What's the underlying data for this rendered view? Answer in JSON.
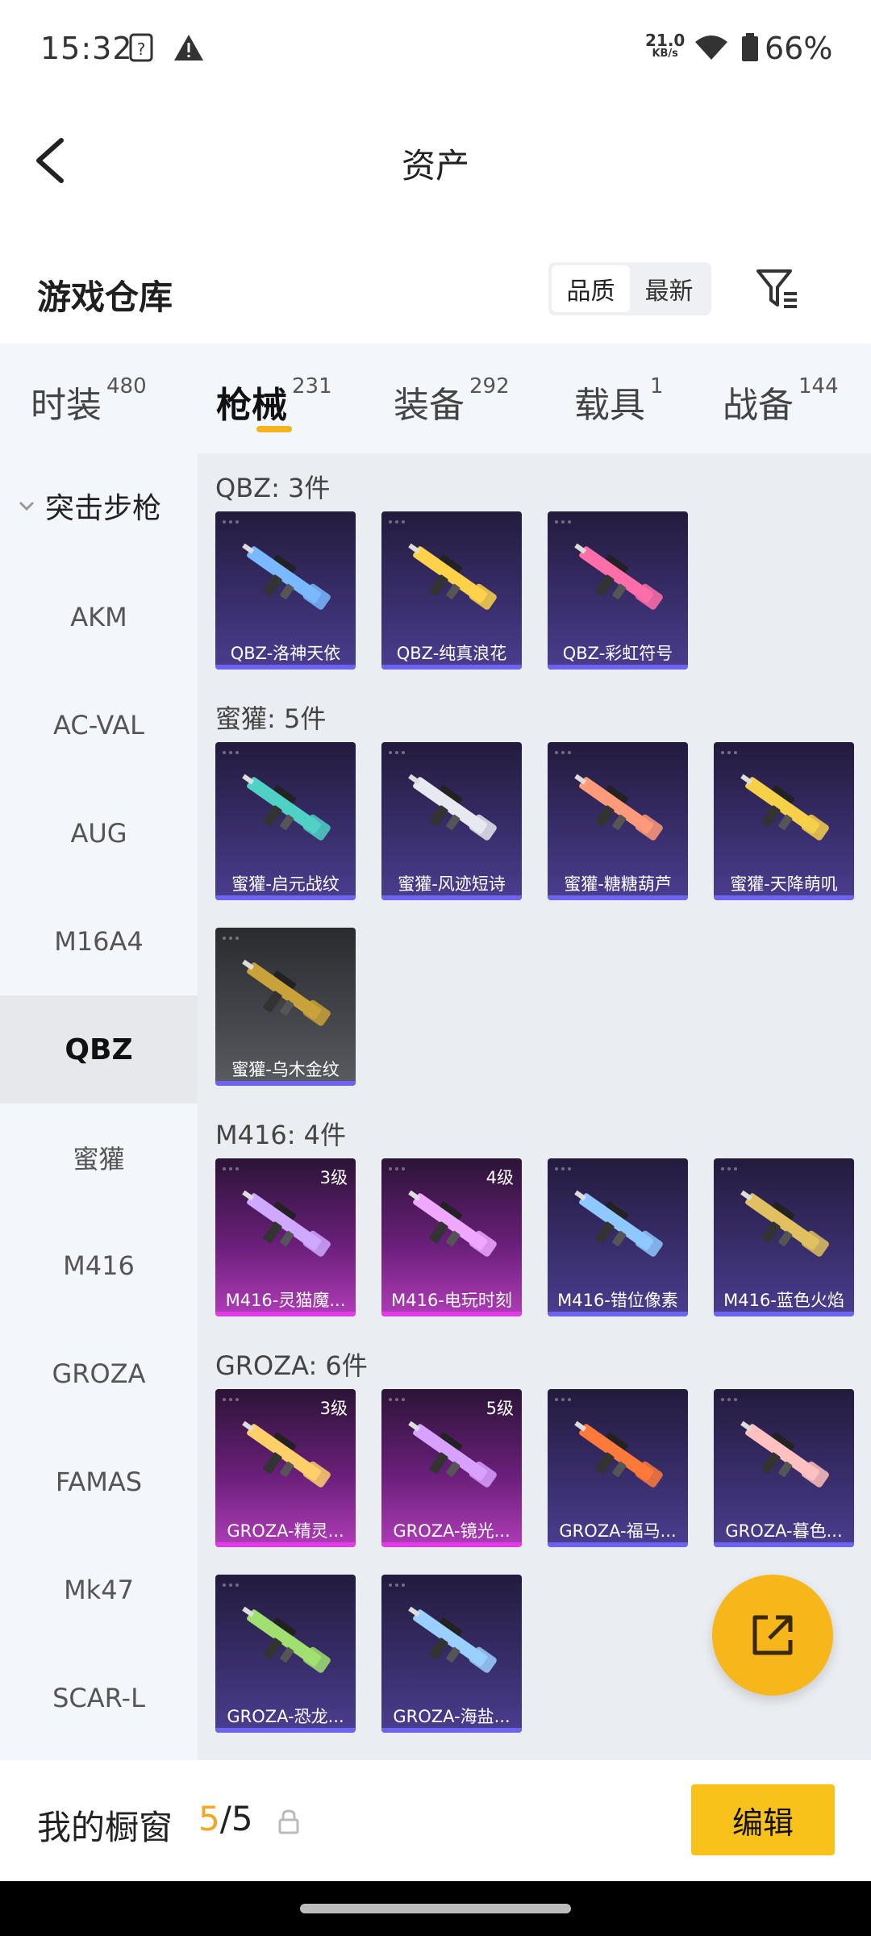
{
  "status_bar": {
    "time": "15:32",
    "net_speed_value": "21.0",
    "net_speed_unit": "KB/s",
    "battery": "66%"
  },
  "header": {
    "title": "资产"
  },
  "section": {
    "title": "游戏仓库",
    "sort_options": [
      "品质",
      "最新"
    ],
    "sort_selected": "品质"
  },
  "categories": [
    {
      "label": "时装",
      "count": "480"
    },
    {
      "label": "枪械",
      "count": "231"
    },
    {
      "label": "装备",
      "count": "292"
    },
    {
      "label": "载具",
      "count": "1"
    },
    {
      "label": "战备",
      "count": "144"
    }
  ],
  "active_category": "枪械",
  "sidebar": {
    "group": "突击步枪",
    "items": [
      "AKM",
      "AC-VAL",
      "AUG",
      "M16A4",
      "QBZ",
      "蜜獾",
      "M416",
      "GROZA",
      "FAMAS",
      "Mk47",
      "SCAR-L"
    ],
    "active": "QBZ"
  },
  "groups": [
    {
      "title": "QBZ: 3件",
      "items": [
        {
          "name": "QBZ-洛神天依",
          "rarity": "purple"
        },
        {
          "name": "QBZ-纯真浪花",
          "rarity": "purple"
        },
        {
          "name": "QBZ-彩虹符号",
          "rarity": "purple"
        }
      ]
    },
    {
      "title": "蜜獾: 5件",
      "items": [
        {
          "name": "蜜獾-启元战纹",
          "rarity": "purple"
        },
        {
          "name": "蜜獾-风迹短诗",
          "rarity": "purple"
        },
        {
          "name": "蜜獾-糖糖葫芦",
          "rarity": "purple"
        },
        {
          "name": "蜜獾-天降萌叽",
          "rarity": "purple"
        },
        {
          "name": "蜜獾-乌木金纹",
          "rarity": "grey"
        }
      ]
    },
    {
      "title": "M416: 4件",
      "items": [
        {
          "name": "M416-灵猫魔...",
          "rarity": "pink",
          "level": "3级"
        },
        {
          "name": "M416-电玩时刻",
          "rarity": "pink",
          "level": "4级"
        },
        {
          "name": "M416-错位像素",
          "rarity": "purple"
        },
        {
          "name": "M416-蓝色火焰",
          "rarity": "purple"
        }
      ]
    },
    {
      "title": "GROZA: 6件",
      "items": [
        {
          "name": "GROZA-精灵...",
          "rarity": "pink",
          "level": "3级"
        },
        {
          "name": "GROZA-镜光...",
          "rarity": "pink",
          "level": "5级"
        },
        {
          "name": "GROZA-福马...",
          "rarity": "purple"
        },
        {
          "name": "GROZA-暮色...",
          "rarity": "purple"
        },
        {
          "name": "GROZA-恐龙...",
          "rarity": "purple"
        },
        {
          "name": "GROZA-海盐...",
          "rarity": "purple"
        }
      ]
    }
  ],
  "bottom_bar": {
    "label": "我的橱窗",
    "current": "5",
    "total": "/5",
    "edit_label": "编辑"
  },
  "colors": {
    "accent": "#f8c21a",
    "purple_bar": "#6c64f0",
    "pink_bar": "#e23ce8"
  }
}
